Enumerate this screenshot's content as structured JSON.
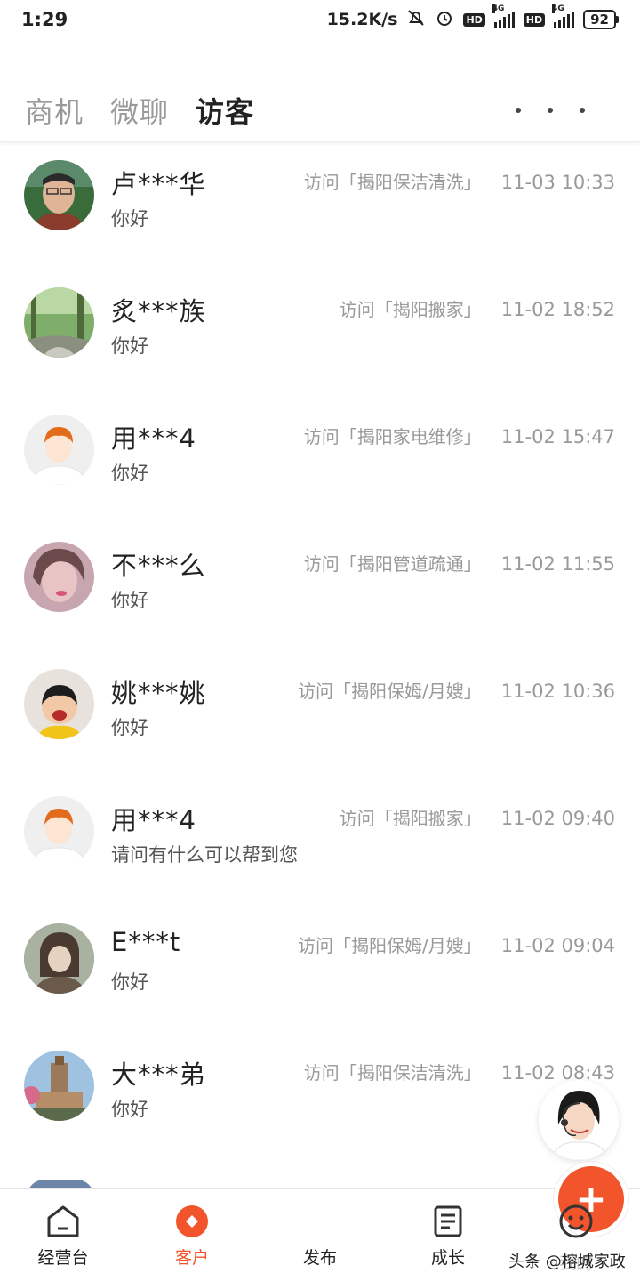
{
  "status_bar": {
    "time": "1:29",
    "net_speed": "15.2K/s",
    "hd1": "HD",
    "hd2": "HD",
    "net1": "4G",
    "net2": "4G",
    "battery": "92"
  },
  "tabs": [
    {
      "label": "商机",
      "active": false
    },
    {
      "label": "微聊",
      "active": false
    },
    {
      "label": "访客",
      "active": true
    }
  ],
  "visitors": [
    {
      "name": "卢***华",
      "message": "你好",
      "visit": "访问「揭阳保洁清洗」",
      "time": "11-03 10:33"
    },
    {
      "name": "炙***族",
      "message": "你好",
      "visit": "访问「揭阳搬家」",
      "time": "11-02 18:52"
    },
    {
      "name": "用***4",
      "message": "你好",
      "visit": "访问「揭阳家电维修」",
      "time": "11-02 15:47"
    },
    {
      "name": "不***么",
      "message": "你好",
      "visit": "访问「揭阳管道疏通」",
      "time": "11-02 11:55"
    },
    {
      "name": "姚***姚",
      "message": "你好",
      "visit": "访问「揭阳保姆/月嫂」",
      "time": "11-02 10:36"
    },
    {
      "name": "用***4",
      "message": "请问有什么可以帮到您",
      "visit": "访问「揭阳搬家」",
      "time": "11-02 09:40"
    },
    {
      "name": "E***t",
      "message": "你好",
      "visit": "访问「揭阳保姆/月嫂」",
      "time": "11-02 09:04"
    },
    {
      "name": "大***弟",
      "message": "你好",
      "visit": "访问「揭阳保洁清洗」",
      "time": "11-02 08:43"
    }
  ],
  "bottom_nav": {
    "dashboard": "经营台",
    "customers": "客户",
    "publish": "发布",
    "growth": "成长",
    "mine": "我的",
    "publish_symbol": "+"
  },
  "watermark": "头条 @榕城家政",
  "colors": {
    "accent": "#f2552c"
  }
}
